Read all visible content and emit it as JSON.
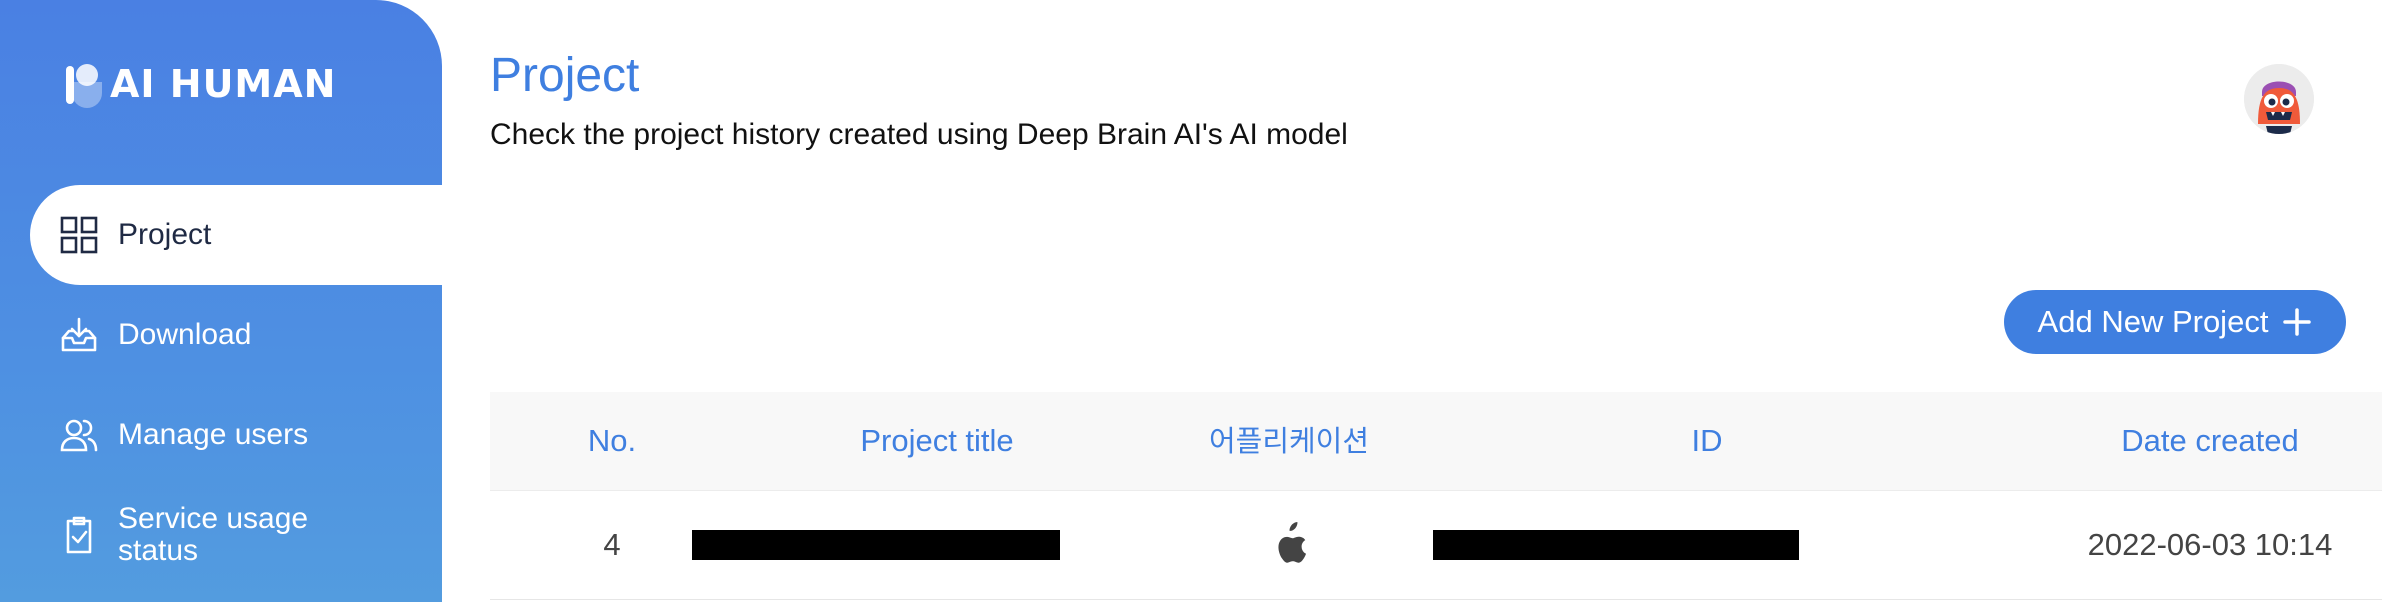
{
  "brand": {
    "logo_text": "AI HUMAN",
    "primary_color": "#3f7fe0"
  },
  "sidebar": {
    "items": [
      {
        "label": "Project",
        "icon": "grid-icon",
        "active": true
      },
      {
        "label": "Download",
        "icon": "download-tray-icon",
        "active": false
      },
      {
        "label": "Manage users",
        "icon": "users-icon",
        "active": false
      },
      {
        "label": "Service usage status",
        "icon": "clipboard-check-icon",
        "active": false
      }
    ]
  },
  "header": {
    "title": "Project",
    "subtitle": "Check the project history created using Deep Brain AI's AI model",
    "avatar_icon": "monster-avatar-icon"
  },
  "toolbar": {
    "add_label": "Add New Project"
  },
  "table": {
    "columns": [
      "No.",
      "Project title",
      "어플리케이션",
      "ID",
      "Date created"
    ],
    "rows": [
      {
        "no": "4",
        "project_title": "[redacted]",
        "application_icon": "apple-icon",
        "id": "[redacted]",
        "date_created": "2022-06-03 10:14"
      }
    ]
  }
}
